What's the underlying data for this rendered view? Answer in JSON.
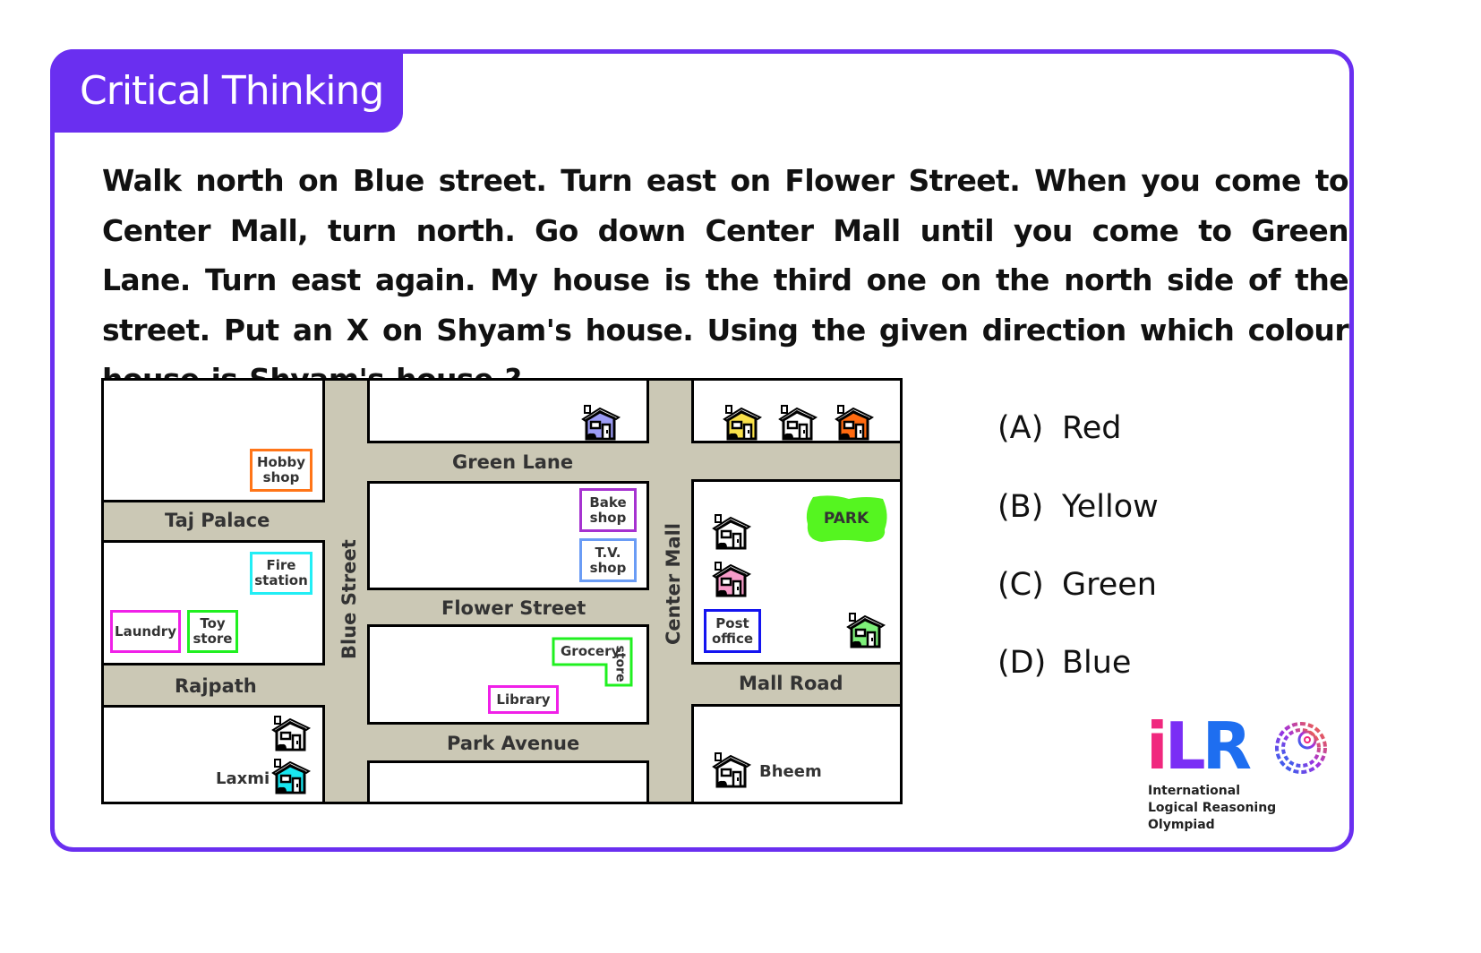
{
  "header": {
    "tag": "Critical Thinking"
  },
  "question": {
    "text": "Walk north on Blue street. Turn east on Flower Street. When you come to Center Mall, turn north. Go down Center Mall until you come to Green Lane. Turn east again. My house is the third one on the north side of the street. Put an X on Shyam's house. Using the given direction which colour house is Shyam's house ?"
  },
  "map": {
    "streets": {
      "green_lane": "Green Lane",
      "taj_palace": "Taj Palace",
      "flower_street": "Flower Street",
      "rajpath": "Rajpath",
      "park_avenue": "Park Avenue",
      "mall_road": "Mall Road",
      "blue_street": "Blue Street",
      "center_mall": "Center Mall"
    },
    "places": {
      "hobby_shop": "Hobby shop",
      "fire_station": "Fire station",
      "laundry": "Laundry",
      "toy_store": "Toy store",
      "bake_shop": "Bake shop",
      "tv_shop": "T.V. shop",
      "grocery": "Grocery",
      "grocery_store_suffix": "store",
      "library": "Library",
      "post_office": "Post office",
      "park": "PARK"
    },
    "residents": {
      "laxmi": "Laxmi",
      "bheem": "Bheem"
    },
    "house_colors": {
      "blue": "#9c9cf5",
      "yellow": "#f8e04a",
      "white": "#ffffff",
      "orange": "#ff6a10",
      "pink": "#f79cc9",
      "green": "#7ef07a",
      "cyan": "#19e6f0"
    },
    "place_colors": {
      "hobby_shop": "#ff7518",
      "fire_station": "#22eef5",
      "laundry": "#f020e8",
      "toy_store": "#20f020",
      "bake_shop": "#a632d0",
      "tv_shop": "#6a9cf5",
      "grocery": "#20f020",
      "library": "#f020e8",
      "post_office": "#1414f0",
      "park": "#55f520"
    }
  },
  "options": [
    {
      "key": "(A)",
      "label": "Red"
    },
    {
      "key": "(B)",
      "label": "Yellow"
    },
    {
      "key": "(C)",
      "label": "Green"
    },
    {
      "key": "(D)",
      "label": "Blue"
    }
  ],
  "logo": {
    "letters": [
      "i",
      "L",
      "R"
    ],
    "letter_colors": [
      "#f0287e",
      "#7a2ef5",
      "#1e6ef0"
    ],
    "line1": "International",
    "line2": "Logical Reasoning",
    "line3": "Olympiad"
  },
  "colors": {
    "accent": "#6a2ff0",
    "road": "#cbc8b5"
  }
}
